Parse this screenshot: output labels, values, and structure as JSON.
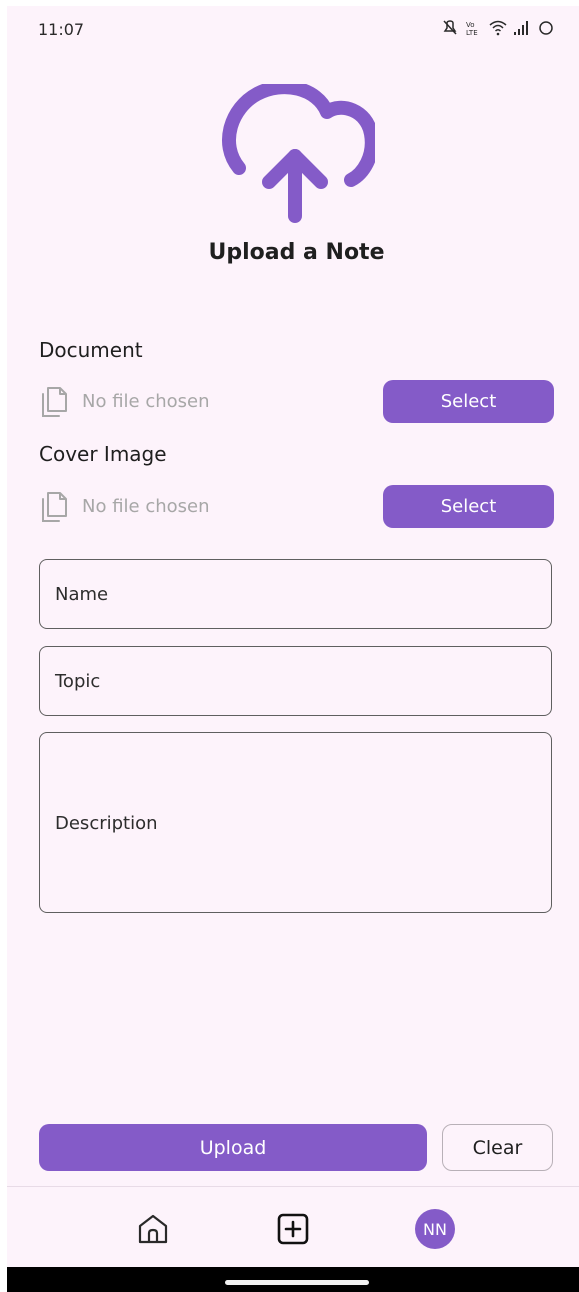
{
  "status_bar": {
    "time": "11:07",
    "icons": [
      "mute-icon",
      "volte-icon",
      "wifi-icon",
      "signal-icon",
      "battery-loading-icon"
    ]
  },
  "page": {
    "title": "Upload a Note",
    "icon": "cloud-upload-icon"
  },
  "document": {
    "label": "Document",
    "status": "No file chosen",
    "button_label": "Select",
    "icon": "file-icon"
  },
  "cover_image": {
    "label": "Cover Image",
    "status": "No file chosen",
    "button_label": "Select",
    "icon": "file-icon"
  },
  "fields": {
    "name_label": "Name",
    "topic_label": "Topic",
    "description_label": "Description"
  },
  "actions": {
    "upload_label": "Upload",
    "clear_label": "Clear"
  },
  "bottom_nav": {
    "items": [
      "home-icon",
      "add-icon"
    ],
    "avatar_initials": "NN"
  },
  "colors": {
    "background": "#fdf3fb",
    "accent": "#845bc8",
    "text": "#1f1f1f",
    "muted_text": "#a7a7a7",
    "border": "#5f5f5f"
  }
}
